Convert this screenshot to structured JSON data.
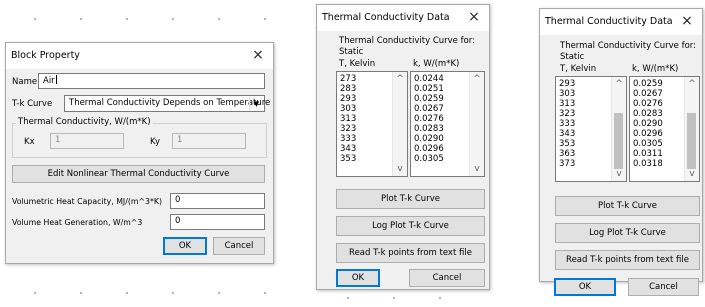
{
  "block_property": {
    "title": "Block Property",
    "name_label": "Name",
    "name_value": "Air",
    "tk_curve_label": "T-k Curve",
    "tk_curve_value": "Thermal Conductivity Depends on Temperature",
    "conductivity_group_label": "Thermal Conductivity, W/(m*K)",
    "kx_label": "Kx",
    "kx_value": "1",
    "ky_label": "Ky",
    "ky_value": "1",
    "edit_curve_button": "Edit Nonlinear Thermal Conductivity Curve",
    "heat_capacity_label": "Volumetric Heat Capacity, MJ/(m^3*K)",
    "heat_capacity_value": "0",
    "heat_generation_label": "Volume Heat Generation, W/m^3",
    "heat_generation_value": "0",
    "ok_button": "OK",
    "cancel_button": "Cancel"
  },
  "tc_dialog_1": {
    "title": "Thermal Conductivity Data",
    "curve_for_label": "Thermal Conductivity Curve for:",
    "curve_name": "Static",
    "t_col_label": "T, Kelvin",
    "k_col_label": "k, W/(m*K)",
    "t_values": "273\n283\n293\n303\n313\n323\n333\n343\n353",
    "k_values": "0.0244\n0.0251\n0.0259\n0.0267\n0.0276\n0.0283\n0.0290\n0.0296\n0.0305",
    "plot_button": "Plot T-k Curve",
    "log_plot_button": "Log Plot T-k Curve",
    "read_button": "Read T-k points from text file",
    "ok_button": "OK",
    "cancel_button": "Cancel"
  },
  "tc_dialog_2": {
    "title": "Thermal Conductivity Data",
    "curve_for_label": "Thermal Conductivity Curve for:",
    "curve_name": "Static",
    "t_col_label": "T, Kelvin",
    "k_col_label": "k, W/(m*K)",
    "t_values": "293\n303\n313\n323\n333\n343\n353\n363\n373",
    "k_values": "0.0259\n0.0267\n0.0276\n0.0283\n0.0290\n0.0296\n0.0305\n0.0311\n0.0318",
    "plot_button": "Plot T-k Curve",
    "log_plot_button": "Log Plot T-k Curve",
    "read_button": "Read T-k points from text file",
    "ok_button": "OK",
    "cancel_button": "Cancel"
  },
  "icons": {
    "close": "×",
    "up_arrow": "^",
    "down_arrow": "v",
    "dropdown_arrow": "▼"
  }
}
